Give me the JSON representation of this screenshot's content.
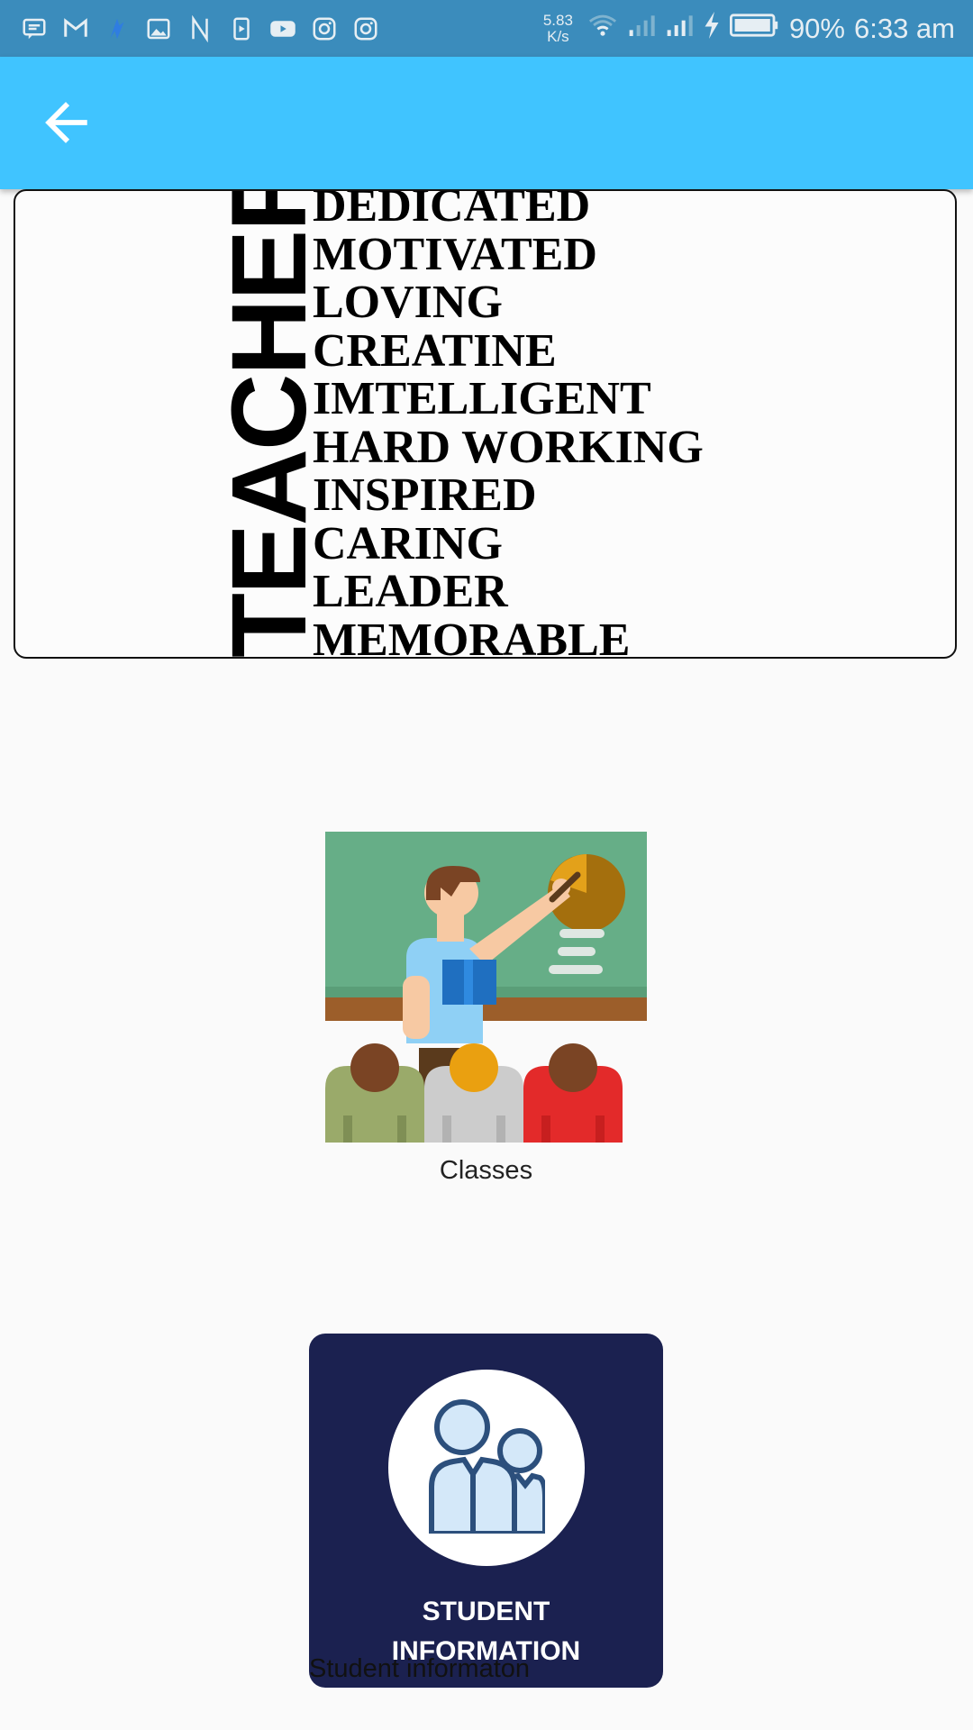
{
  "status_bar": {
    "net_speed_value": "5.83",
    "net_speed_unit": "K/s",
    "battery": "90%",
    "time": "6:33 am",
    "left_icons": [
      "message-icon",
      "gmail-icon",
      "app-icon",
      "gallery-icon",
      "n-icon",
      "media-icon",
      "youtube-icon",
      "instagram-icon",
      "instagram-icon"
    ]
  },
  "app_bar": {
    "back_icon": "arrow-back-icon",
    "color": "#40c4ff"
  },
  "banner": {
    "vertical_word": "TEACHER",
    "words": [
      "DEDICATED",
      "MOTIVATED",
      "LOVING",
      "CREATINE",
      "IMTELLIGENT",
      "HARD WORKING",
      "INSPIRED",
      "CARING",
      "LEADER",
      "MEMORABLE"
    ]
  },
  "menu": {
    "classes_label": "Classes",
    "student_tile_title_line1": "STUDENT",
    "student_tile_title_line2": "INFORMATION",
    "student_caption": "Student informaton",
    "student_tile_color": "#1b2150"
  }
}
